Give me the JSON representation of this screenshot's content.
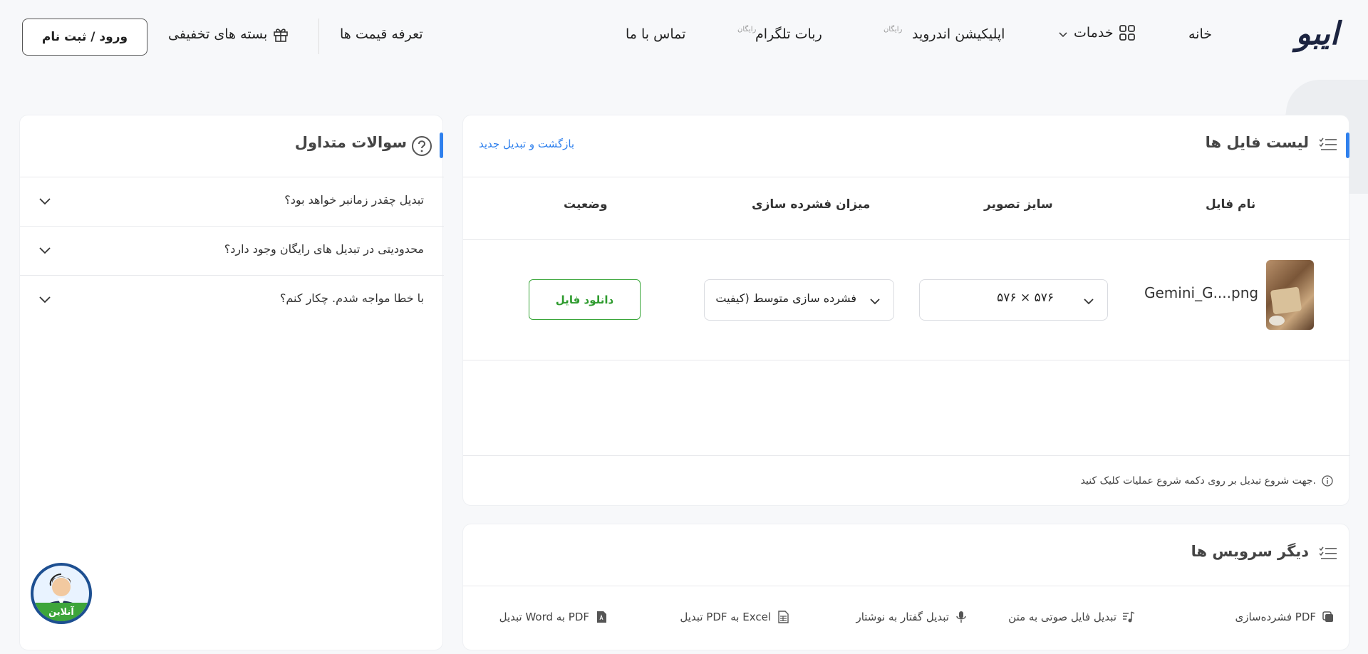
{
  "header": {
    "logo": "ایبو",
    "nav": {
      "home": "خانه",
      "services": "خدمات",
      "android_app": "اپلیکیشن اندروید",
      "android_app_badge": "رایگان",
      "telegram_bot": "ربات تلگرام",
      "telegram_bot_badge": "رایگان",
      "contact": "تماس با ما",
      "pricing": "تعرفه قیمت ها",
      "discount_packages": "بسته های تخفیفی"
    },
    "login_label": "ورود / ثبت نام"
  },
  "file_list": {
    "title": "لیست فایل ها",
    "back_link": "بازگشت و تبدیل جدید",
    "columns": {
      "file_name": "نام فایل",
      "image_size": "سایز تصویر",
      "compression": "میزان فشرده سازی",
      "status": "وضعیت"
    },
    "rows": [
      {
        "file_name": "Gemini_G....png",
        "image_size": "۵۷۶ × ۵۷۶",
        "compression": "فشرده سازی متوسط (کیفیت",
        "download_label": "دانلود فایل"
      }
    ],
    "hint": "جهت شروع تبدیل بر روی دکمه شروع عملیات کلیک کنید."
  },
  "other_services": {
    "title": "دیگر سرویس ها",
    "items": [
      {
        "label": "فشرده‌سازی PDF",
        "icon": "pdf-compress-icon"
      },
      {
        "label": "تبدیل فایل صوتی به متن",
        "icon": "music-note-icon"
      },
      {
        "label": "تبدیل گفتار به نوشتار",
        "icon": "microphone-icon"
      },
      {
        "label": "تبدیل PDF به Excel",
        "icon": "spreadsheet-icon"
      },
      {
        "label": "تبدیل Word به PDF",
        "icon": "pdf-file-icon"
      }
    ]
  },
  "faq": {
    "title": "سوالات متداول",
    "items": [
      "تبدیل چقدر زمانبر خواهد بود؟",
      "محدودیتی در تبدیل های رایگان وجود دارد؟",
      "با خطا مواجه شدم. چکار کنم؟"
    ]
  },
  "support": {
    "online_label": "آنلاین"
  },
  "colors": {
    "accent": "#2f80ed",
    "download_green": "#2e9b2e",
    "logo_navy": "#1c2440"
  }
}
